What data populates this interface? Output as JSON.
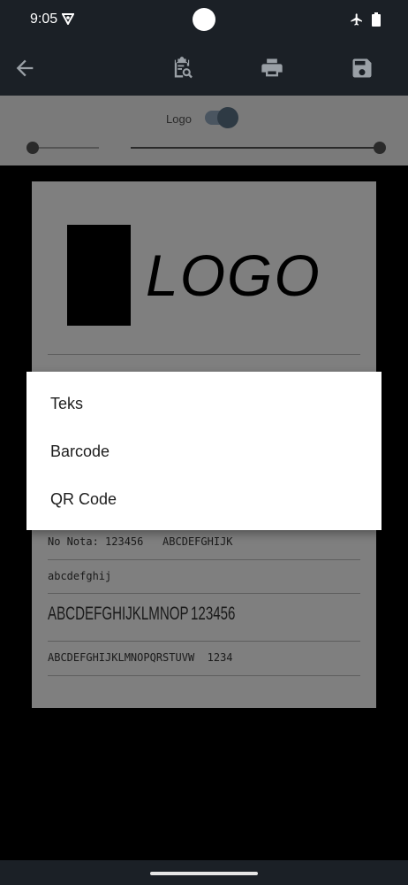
{
  "status_bar": {
    "time": "9:05",
    "icons": [
      "vpn-key-icon",
      "airplane-mode-icon",
      "battery-icon"
    ]
  },
  "app_bar": {
    "icons": [
      "back-arrow-icon",
      "clipboard-search-icon",
      "print-icon",
      "save-icon"
    ]
  },
  "toolbar": {
    "logo_label": "Logo",
    "logo_toggle_on": true
  },
  "receipt": {
    "logo_text": "LOGO",
    "row1": "No Nota: 123456   ABCDEFGHIJK",
    "row2": "abcdefghij",
    "row3_left": "ABCDEFGHIJKLMNOP",
    "row3_right": "123456",
    "row4": "ABCDEFGHIJKLMNOPQRSTUVW  1234"
  },
  "dialog": {
    "items": [
      "Teks",
      "Barcode",
      "QR Code"
    ]
  },
  "colors": {
    "bar_background": "#1b2026",
    "scrim_gray": "#7a7a7a",
    "dialog_background": "#ffffff"
  }
}
